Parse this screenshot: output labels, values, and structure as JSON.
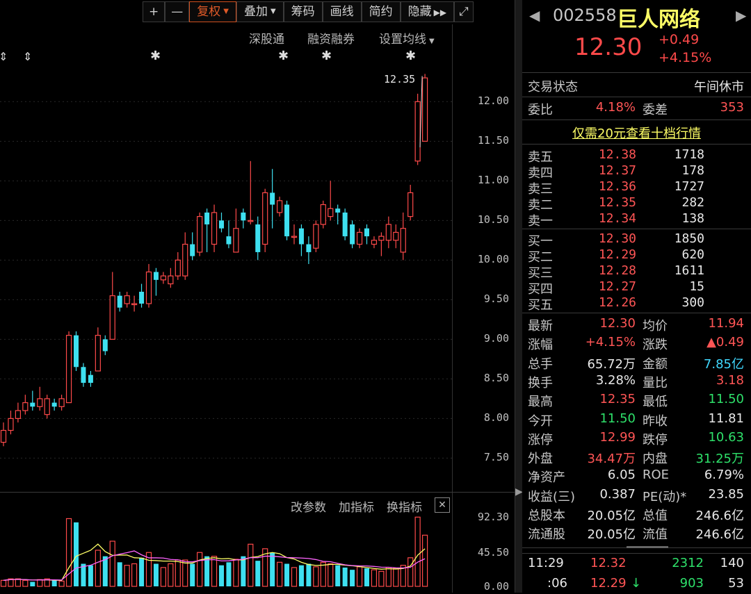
{
  "toolbar": {
    "plus": "+",
    "minus": "—",
    "fuquan": "复权",
    "diejia": "叠加",
    "chouma": "筹码",
    "huaxian": "画线",
    "jianyue": "简约",
    "yincang": "隐藏",
    "expand": "⤢"
  },
  "subbar": {
    "shengutong": "深股通",
    "rongzi": "融资融券",
    "junxian": "设置均线"
  },
  "chart": {
    "price_ticks": [
      "12.00",
      "11.50",
      "11.00",
      "10.50",
      "10.00",
      "9.50",
      "9.00",
      "8.50",
      "8.00",
      "7.50"
    ],
    "high_annotation": "12.35",
    "vol_ticks": [
      "92.30",
      "45.50",
      "0.00"
    ],
    "indicator_bar": {
      "param": "改参数",
      "add": "加指标",
      "swap": "换指标",
      "close": "✕"
    }
  },
  "chart_data": {
    "type": "candlestick",
    "ylim": [
      7.2,
      12.5
    ],
    "candles": [
      [
        7.7,
        7.85,
        7.95,
        7.65
      ],
      [
        7.85,
        8.0,
        8.1,
        7.8
      ],
      [
        8.0,
        8.1,
        8.2,
        7.95
      ],
      [
        8.1,
        8.2,
        8.3,
        8.05
      ],
      [
        8.2,
        8.15,
        8.35,
        8.1
      ],
      [
        8.15,
        8.25,
        8.4,
        8.1
      ],
      [
        8.05,
        8.25,
        8.3,
        8.0
      ],
      [
        8.2,
        8.15,
        8.25,
        8.1
      ],
      [
        8.15,
        8.25,
        8.3,
        8.1
      ],
      [
        8.2,
        9.05,
        9.1,
        8.2
      ],
      [
        9.05,
        8.65,
        9.1,
        8.6
      ],
      [
        8.65,
        8.45,
        8.7,
        8.4
      ],
      [
        8.55,
        8.45,
        8.6,
        8.4
      ],
      [
        8.6,
        9.05,
        9.15,
        8.6
      ],
      [
        9.0,
        8.85,
        9.05,
        8.8
      ],
      [
        9.0,
        9.55,
        9.85,
        9.0
      ],
      [
        9.55,
        9.4,
        9.6,
        9.35
      ],
      [
        9.45,
        9.55,
        9.6,
        9.4
      ],
      [
        9.45,
        9.45,
        9.55,
        9.35
      ],
      [
        9.6,
        9.45,
        9.7,
        9.4
      ],
      [
        9.45,
        9.85,
        9.95,
        9.4
      ],
      [
        9.85,
        9.75,
        9.9,
        9.55
      ],
      [
        9.75,
        9.8,
        9.85,
        9.7
      ],
      [
        9.7,
        9.8,
        9.9,
        9.65
      ],
      [
        9.8,
        10.0,
        10.1,
        9.75
      ],
      [
        9.8,
        10.2,
        10.35,
        9.75
      ],
      [
        10.2,
        10.05,
        10.35,
        10.0
      ],
      [
        10.1,
        10.55,
        10.6,
        10.05
      ],
      [
        10.6,
        10.45,
        10.65,
        10.1
      ],
      [
        10.2,
        10.6,
        10.7,
        10.1
      ],
      [
        10.5,
        10.4,
        10.6,
        10.35
      ],
      [
        10.3,
        10.2,
        10.5,
        10.15
      ],
      [
        10.1,
        10.4,
        10.65,
        10.1
      ],
      [
        10.6,
        10.5,
        10.65,
        10.4
      ],
      [
        10.5,
        10.5,
        11.25,
        10.45
      ],
      [
        10.45,
        10.1,
        10.55,
        10.0
      ],
      [
        10.2,
        10.85,
        10.9,
        10.1
      ],
      [
        10.85,
        10.7,
        11.15,
        10.4
      ],
      [
        10.6,
        10.75,
        10.8,
        10.55
      ],
      [
        10.7,
        10.3,
        10.75,
        10.25
      ],
      [
        10.3,
        10.3,
        10.45,
        10.2
      ],
      [
        10.4,
        10.2,
        10.45,
        10.05
      ],
      [
        10.2,
        10.1,
        10.3,
        9.95
      ],
      [
        10.15,
        10.45,
        10.5,
        10.1
      ],
      [
        10.45,
        10.7,
        10.75,
        10.4
      ],
      [
        10.55,
        10.65,
        11.0,
        10.5
      ],
      [
        10.65,
        10.6,
        10.7,
        10.45
      ],
      [
        10.6,
        10.3,
        10.65,
        10.25
      ],
      [
        10.45,
        10.2,
        10.5,
        10.15
      ],
      [
        10.2,
        10.35,
        10.4,
        10.15
      ],
      [
        10.4,
        10.3,
        10.45,
        10.2
      ],
      [
        10.2,
        10.25,
        10.3,
        10.15
      ],
      [
        10.25,
        10.3,
        10.35,
        10.05
      ],
      [
        10.25,
        10.45,
        10.55,
        10.15
      ],
      [
        10.25,
        10.35,
        10.45,
        10.15
      ],
      [
        10.1,
        10.4,
        10.6,
        10.0
      ],
      [
        10.55,
        10.85,
        10.95,
        10.5
      ],
      [
        11.25,
        12.0,
        12.1,
        11.2
      ],
      [
        11.5,
        12.3,
        12.35,
        11.5
      ]
    ],
    "volume_ylim": [
      0,
      92.3
    ]
  },
  "stock": {
    "code": "002558",
    "name": "巨人网络",
    "price": "12.30",
    "change": "+0.49",
    "pct": "+4.15%"
  },
  "status": {
    "label": "交易状态",
    "value": "午间休市"
  },
  "weibi": {
    "label": "委比",
    "value": "4.18%",
    "label2": "委差",
    "value2": "353"
  },
  "promo": "仅需20元查看十档行情",
  "asks": [
    {
      "label": "卖五",
      "price": "12.38",
      "vol": "1718"
    },
    {
      "label": "卖四",
      "price": "12.37",
      "vol": "178"
    },
    {
      "label": "卖三",
      "price": "12.36",
      "vol": "1727"
    },
    {
      "label": "卖二",
      "price": "12.35",
      "vol": "282"
    },
    {
      "label": "卖一",
      "price": "12.34",
      "vol": "138"
    }
  ],
  "bids": [
    {
      "label": "买一",
      "price": "12.30",
      "vol": "1850"
    },
    {
      "label": "买二",
      "price": "12.29",
      "vol": "620"
    },
    {
      "label": "买三",
      "price": "12.28",
      "vol": "1611"
    },
    {
      "label": "买四",
      "price": "12.27",
      "vol": "15"
    },
    {
      "label": "买五",
      "price": "12.26",
      "vol": "300"
    }
  ],
  "stats": [
    {
      "l1": "最新",
      "v1": "12.30",
      "c1": "red",
      "l2": "均价",
      "v2": "11.94",
      "c2": "red"
    },
    {
      "l1": "涨幅",
      "v1": "+4.15%",
      "c1": "red",
      "l2": "涨跌",
      "v2": "▲0.49",
      "c2": "red"
    },
    {
      "l1": "总手",
      "v1": "65.72万",
      "c1": "white",
      "l2": "金额",
      "v2": "7.85亿",
      "c2": "cyan"
    },
    {
      "l1": "换手",
      "v1": "3.28%",
      "c1": "white",
      "l2": "量比",
      "v2": "3.18",
      "c2": "red"
    },
    {
      "l1": "最高",
      "v1": "12.35",
      "c1": "red",
      "l2": "最低",
      "v2": "11.50",
      "c2": "green"
    },
    {
      "l1": "今开",
      "v1": "11.50",
      "c1": "green",
      "l2": "昨收",
      "v2": "11.81",
      "c2": "white"
    },
    {
      "l1": "涨停",
      "v1": "12.99",
      "c1": "red",
      "l2": "跌停",
      "v2": "10.63",
      "c2": "green"
    },
    {
      "l1": "外盘",
      "v1": "34.47万",
      "c1": "red",
      "l2": "内盘",
      "v2": "31.25万",
      "c2": "green"
    },
    {
      "l1": "净资产",
      "v1": "6.05",
      "c1": "white",
      "l2": "ROE",
      "v2": "6.79%",
      "c2": "white"
    },
    {
      "l1": "收益(三)",
      "v1": "0.387",
      "c1": "white",
      "l2": "PE(动)*",
      "v2": "23.85",
      "c2": "white"
    },
    {
      "l1": "总股本",
      "v1": "20.05亿",
      "c1": "white",
      "l2": "总值",
      "v2": "246.6亿",
      "c2": "white"
    },
    {
      "l1": "流通股",
      "v1": "20.05亿",
      "c1": "white",
      "l2": "流值",
      "v2": "246.6亿",
      "c2": "white"
    }
  ],
  "ticks": [
    {
      "time": "11:29",
      "price": "12.32",
      "vol": "2312",
      "num": "140"
    },
    {
      "time": ":06",
      "price": "12.29",
      "vol": "903",
      "num": "53",
      "arrow": "↓"
    }
  ],
  "colors": {
    "up": "#ff4a4a",
    "down": "#3ee0f0",
    "ma5": "#ffff66",
    "ma10": "#ff66ff"
  }
}
